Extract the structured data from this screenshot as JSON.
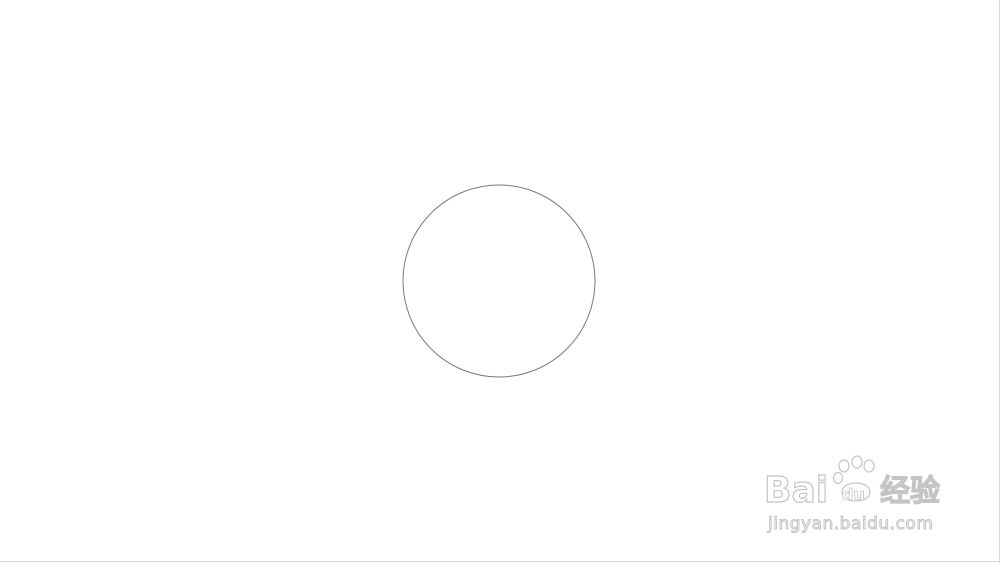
{
  "canvas": {
    "background": "#ffffff",
    "border_color": "#d8d8d8"
  },
  "shape": {
    "type": "circle",
    "stroke_color": "#7a7a7a",
    "fill": "none"
  },
  "watermark": {
    "logo_text": "Baidu经验",
    "url": "jingyan.baidu.com",
    "color": "#c4c4c4"
  }
}
